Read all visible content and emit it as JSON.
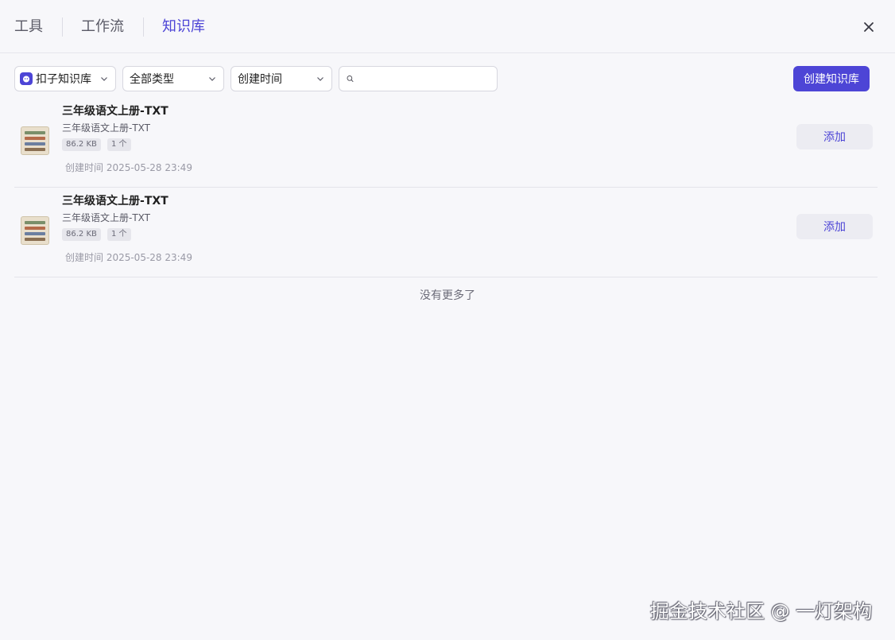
{
  "tabs": [
    {
      "label": "工具",
      "active": false
    },
    {
      "label": "工作流",
      "active": false
    },
    {
      "label": "知识库",
      "active": true
    }
  ],
  "filters": {
    "library": "扣子知识库",
    "type": "全部类型",
    "sort": "创建时间"
  },
  "search": {
    "value": "",
    "placeholder": ""
  },
  "create_button": "创建知识库",
  "items": [
    {
      "title": "三年级语文上册-TXT",
      "description": "三年级语文上册-TXT",
      "size": "86.2 KB",
      "count": "1 个",
      "created": "创建时间 2025-05-28 23:49",
      "action": "添加"
    },
    {
      "title": "三年级语文上册-TXT",
      "description": "三年级语文上册-TXT",
      "size": "86.2 KB",
      "count": "1 个",
      "created": "创建时间 2025-05-28 23:49",
      "action": "添加"
    }
  ],
  "no_more": "没有更多了",
  "watermark": "掘金技术社区 @ 一灯架构",
  "colors": {
    "accent": "#4d45d6",
    "background": "#f7f7fa",
    "secondary_button": "#ececf2"
  },
  "icons": {
    "close": "close-icon",
    "chevron": "chevron-down-icon",
    "search": "search-icon",
    "library": "knowledge-library-icon",
    "thumbnail": "book-thumbnail-icon"
  }
}
